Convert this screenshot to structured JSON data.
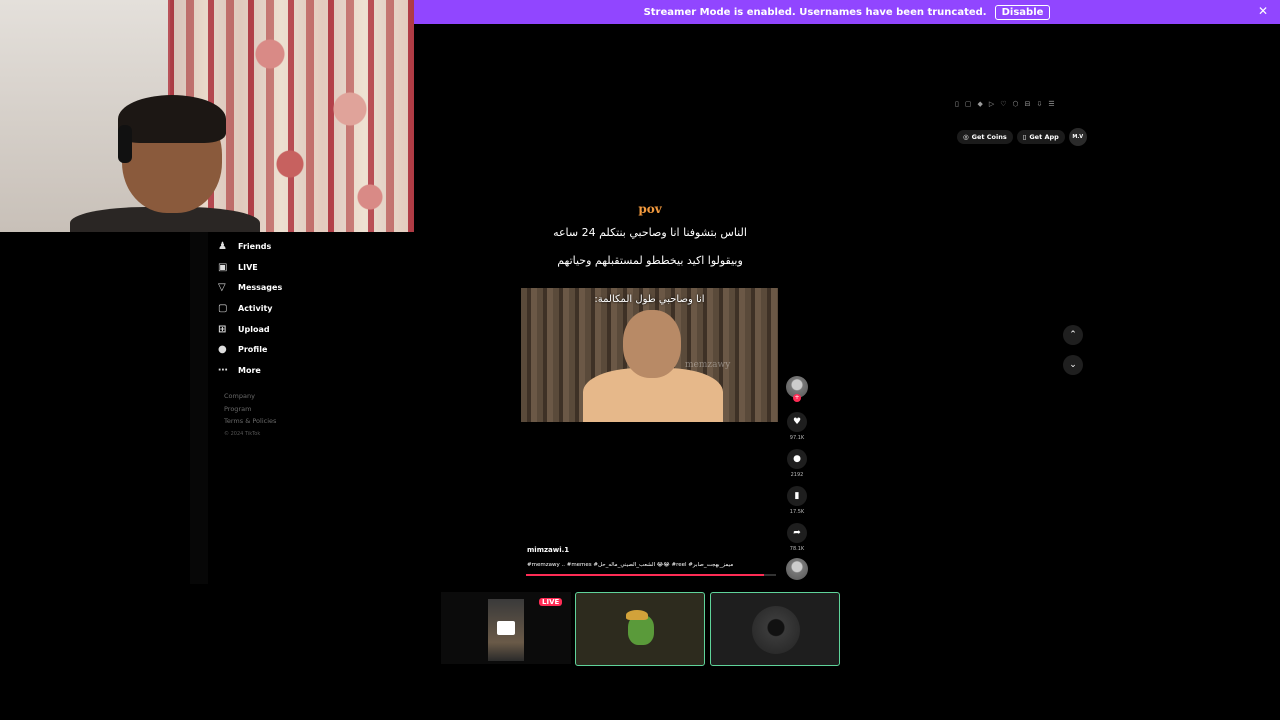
{
  "banner": {
    "message": "Streamer Mode is enabled. Usernames have been truncated.",
    "disable_label": "Disable",
    "close_icon": "close-icon",
    "color": "#9146ff"
  },
  "sidebar": {
    "items": [
      {
        "label": "Friends",
        "icon": "friends-icon",
        "glyph": "♟"
      },
      {
        "label": "LIVE",
        "icon": "live-icon",
        "glyph": "▣"
      },
      {
        "label": "Messages",
        "icon": "messages-icon",
        "glyph": "▽"
      },
      {
        "label": "Activity",
        "icon": "activity-icon",
        "glyph": "▢"
      },
      {
        "label": "Upload",
        "icon": "upload-icon",
        "glyph": "⊞"
      },
      {
        "label": "Profile",
        "icon": "profile-icon",
        "glyph": "●"
      },
      {
        "label": "More",
        "icon": "more-icon",
        "glyph": "⋯"
      }
    ],
    "footer": {
      "company": "Company",
      "program": "Program",
      "terms": "Terms & Policies",
      "copyright": "© 2024 TikTok"
    }
  },
  "header": {
    "get_coins": "Get Coins",
    "get_app": "Get App",
    "avatar_text": "M.V"
  },
  "post": {
    "pov": "pov",
    "caption_line1": "الناس بتشوفنا انا وصاحبي بنتكلم 24 ساعه",
    "caption_line2": "وبيقولوا اكيد بيخططو لمستقبلهم وحياتهم",
    "video_subtitle": "انا وصاحبي طول المكالمة:",
    "watermark": "memzawy",
    "username": "mimzawi.1",
    "hashtags": "#memzawy .. #memes #الشعب_الصيني_ماله_حل 😂😂 #reel #ميمز_بهجت_صابر",
    "progress": 0.95,
    "likes": "97.1K",
    "comments": "2192",
    "saves": "17.5K",
    "shares": "78.1K"
  },
  "thumbnails": {
    "live_badge": "LIVE"
  },
  "colors": {
    "accent": "#fe2c55",
    "pov": "#f39a3e",
    "thumb_border": "#5fd39a"
  }
}
